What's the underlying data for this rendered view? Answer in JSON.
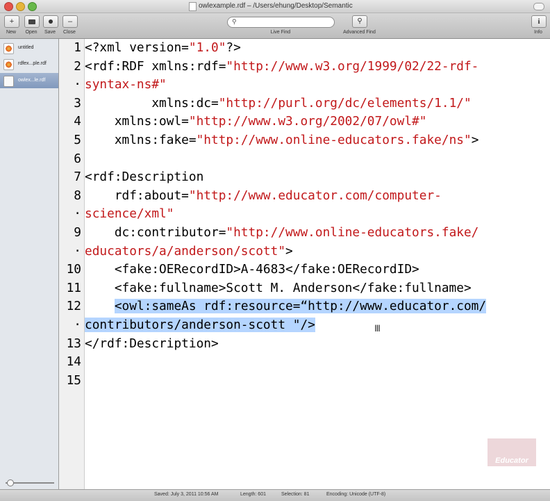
{
  "window": {
    "title": "owlexample.rdf – /Users/ehung/Desktop/Semantic"
  },
  "toolbar": {
    "new_label": "New",
    "open_label": "Open",
    "save_label": "Save",
    "close_label": "Close",
    "live_find_label": "Live Find",
    "advanced_find_label": "Advanced Find",
    "info_label": "Info"
  },
  "sidebar": {
    "items": [
      {
        "label": "untitled",
        "icon": "document-red-icon"
      },
      {
        "label": "rdfex...ple.rdf",
        "icon": "document-red-icon"
      },
      {
        "label": "owlex...le.rdf",
        "icon": "document-white-icon"
      }
    ]
  },
  "editor": {
    "line_numbers": [
      "1",
      "·",
      "2",
      "·",
      "3",
      "4",
      "5",
      "6",
      "7",
      "8",
      "·",
      "9",
      "·",
      "10",
      "11",
      "12",
      "·",
      "13",
      "14",
      "15"
    ],
    "lines": [
      {
        "n": "1",
        "parts": [
          {
            "t": "<?xml version=",
            "c": "k"
          },
          {
            "t": "\"1.0\"",
            "c": "s"
          },
          {
            "t": "?>",
            "c": "k"
          }
        ]
      },
      {
        "n": "2",
        "parts": [
          {
            "t": "<rdf:RDF xmlns:rdf=",
            "c": "k"
          },
          {
            "t": "\"http://www.w3.org/1999/02/22-rdf-",
            "c": "s"
          }
        ]
      },
      {
        "n": "·",
        "parts": [
          {
            "t": "syntax-ns#\"",
            "c": "s"
          }
        ]
      },
      {
        "n": "3",
        "parts": [
          {
            "t": "         xmlns:dc=",
            "c": "k"
          },
          {
            "t": "\"http://purl.org/dc/elements/1.1/\"",
            "c": "s"
          }
        ]
      },
      {
        "n": "4",
        "parts": [
          {
            "t": "    xmlns:owl=",
            "c": "k"
          },
          {
            "t": "\"http://www.w3.org/2002/07/owl#\"",
            "c": "s"
          }
        ]
      },
      {
        "n": "5",
        "parts": [
          {
            "t": "    xmlns:fake=",
            "c": "k"
          },
          {
            "t": "\"http://www.online-educators.fake/ns\"",
            "c": "s"
          },
          {
            "t": ">",
            "c": "k"
          }
        ]
      },
      {
        "n": "6",
        "parts": []
      },
      {
        "n": "7",
        "parts": [
          {
            "t": "<rdf:Description",
            "c": "k"
          }
        ]
      },
      {
        "n": "8",
        "parts": [
          {
            "t": "    rdf:about=",
            "c": "k"
          },
          {
            "t": "\"http://www.educator.com/computer-",
            "c": "s"
          }
        ]
      },
      {
        "n": "·",
        "parts": [
          {
            "t": "science/xml\"",
            "c": "s"
          }
        ]
      },
      {
        "n": "9",
        "parts": [
          {
            "t": "    dc:contributor=",
            "c": "k"
          },
          {
            "t": "\"http://www.online-educators.fake/",
            "c": "s"
          }
        ]
      },
      {
        "n": "·",
        "parts": [
          {
            "t": "educators/a/anderson/scott\"",
            "c": "s"
          },
          {
            "t": ">",
            "c": "k"
          }
        ]
      },
      {
        "n": "10",
        "parts": [
          {
            "t": "    <fake:OERecordID>A-4683</fake:OERecordID>",
            "c": "k"
          }
        ]
      },
      {
        "n": "11",
        "parts": [
          {
            "t": "    <fake:fullname>Scott M. Anderson</fake:fullname>",
            "c": "k"
          }
        ]
      },
      {
        "n": "12",
        "parts": [
          {
            "t": "    ",
            "c": "k"
          },
          {
            "t": "<owl:sameAs rdf:resource=“http://www.educator.com/",
            "c": "sel"
          }
        ]
      },
      {
        "n": "·",
        "parts": [
          {
            "t": "contributors/anderson-scott \"/>",
            "c": "sel"
          }
        ]
      },
      {
        "n": "13",
        "parts": [
          {
            "t": "</rdf:Description>",
            "c": "k"
          }
        ]
      },
      {
        "n": "14",
        "parts": []
      },
      {
        "n": "15",
        "parts": []
      }
    ]
  },
  "statusbar": {
    "saved": "Saved: July 3, 2011 10:56 AM",
    "length": "Length: 601",
    "selection": "Selection: 81",
    "encoding": "Encoding: Unicode (UTF-8)"
  },
  "watermark": {
    "text": "Educator"
  },
  "colors": {
    "string": "#c2191b",
    "selection": "#b5d5ff"
  }
}
